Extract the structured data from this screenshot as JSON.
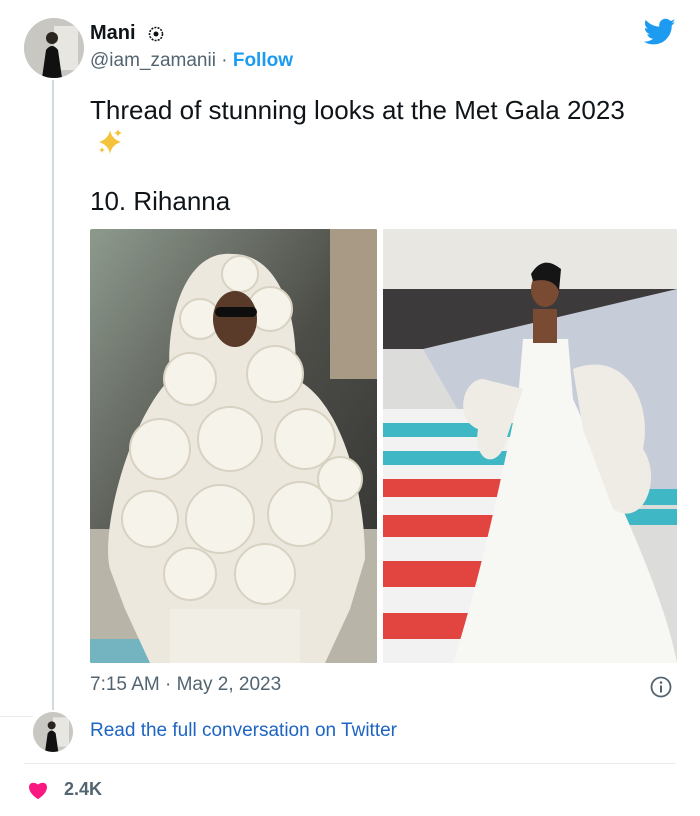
{
  "tweet": {
    "author_name": "Mani",
    "handle": "@iam_zamanii",
    "separator": "·",
    "follow_label": "Follow",
    "text_line": "Thread of stunning looks at the Met Gala 2023",
    "subtext": "10. Rihanna",
    "time": "7:15 AM",
    "date": "May 2, 2023",
    "read_more": "Read the full conversation on Twitter",
    "likes": "2.4K"
  },
  "colors": {
    "link": "#1d9bf0",
    "read_link": "#1d64c3",
    "heart": "#f91880",
    "twitter_blue": "#1d9bf0",
    "muted": "#536471"
  },
  "icons": {
    "verified": "badge-icon",
    "twitter": "twitter-bird-icon",
    "sparkles": "sparkles-icon",
    "info": "info-icon",
    "like": "heart-icon"
  }
}
